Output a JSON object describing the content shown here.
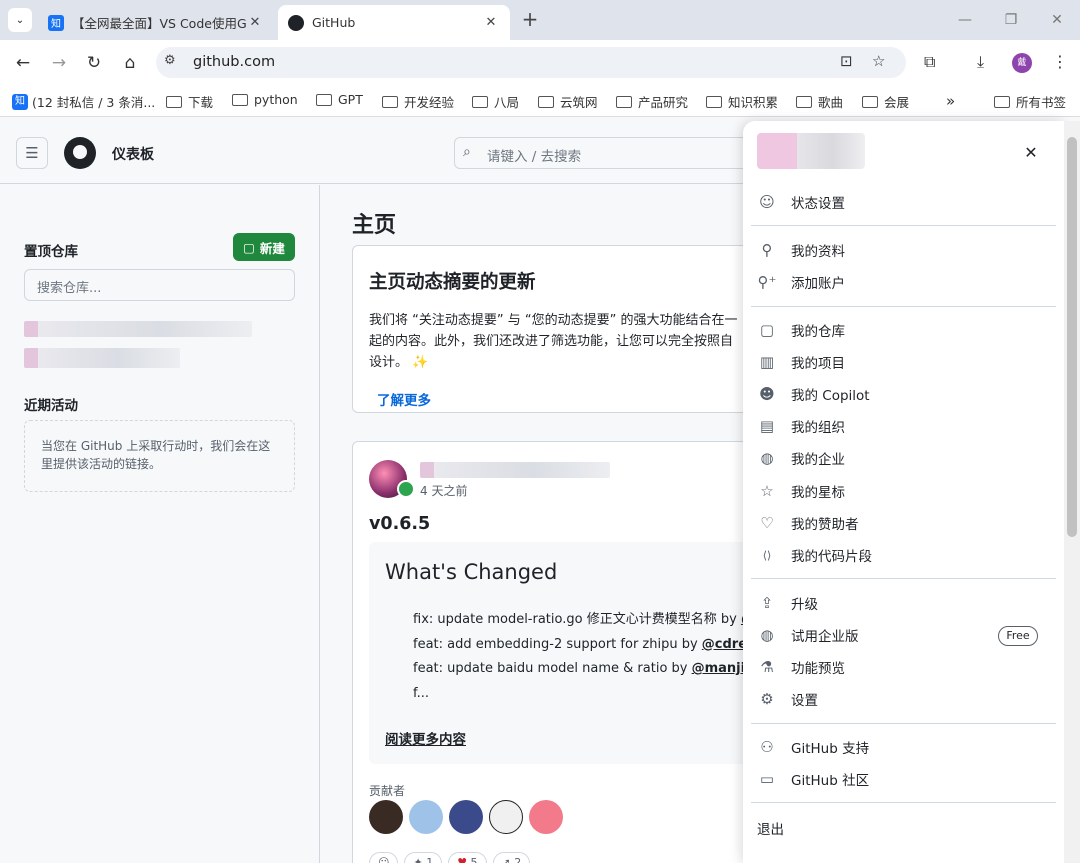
{
  "browser": {
    "tabs": [
      {
        "title": "【全网最全面】VS Code使用G",
        "favicon": "知",
        "active": false
      },
      {
        "title": "GitHub",
        "favicon": "github-icon",
        "active": true
      }
    ],
    "url": "github.com",
    "profile_initial": "戴",
    "bookmarks": [
      {
        "label": "(12 封私信 / 3 条消...",
        "type": "site"
      },
      {
        "label": "下载",
        "type": "folder"
      },
      {
        "label": "python",
        "type": "folder"
      },
      {
        "label": "GPT",
        "type": "folder"
      },
      {
        "label": "开发经验",
        "type": "folder"
      },
      {
        "label": "八局",
        "type": "folder"
      },
      {
        "label": "云筑网",
        "type": "folder"
      },
      {
        "label": "产品研究",
        "type": "folder"
      },
      {
        "label": "知识积累",
        "type": "folder"
      },
      {
        "label": "歌曲",
        "type": "folder"
      },
      {
        "label": "会展",
        "type": "folder"
      }
    ],
    "all_bookmarks": "所有书签",
    "more": "»"
  },
  "header": {
    "title": "仪表板",
    "search_placeholder": "请键入 / 去搜索",
    "slash_key": "/"
  },
  "sidebar": {
    "top_repos_heading": "置顶仓库",
    "new_button": "新建",
    "repo_search_placeholder": "搜索仓库...",
    "recent_heading": "近期活动",
    "recent_empty": "当您在 GitHub 上采取行动时，我们会在这里提供该活动的链接。"
  },
  "main": {
    "title": "主页",
    "update_card": {
      "title": "主页动态摘要的更新",
      "body": "我们将 “关注动态提要” 与 “您的动态提要” 的强大功能结合在一起的内容。此外，我们还改进了筛选功能，让您可以完全按照自设计。 ✨",
      "link": "了解更多"
    },
    "release_card": {
      "time": "4 天之前",
      "version": "v0.6.5",
      "changes_title": "What's Changed",
      "changes": [
        {
          "text": "fix: update model-ratio.go 修正文心计费模型名称 by ",
          "mention": "@"
        },
        {
          "text": "feat: add embedding-2 support for zhipu by ",
          "mention": "@cdredf"
        },
        {
          "text": "feat: update baidu model name & ratio by ",
          "mention": "@manjieqi"
        },
        {
          "text": "f...",
          "mention": ""
        }
      ],
      "read_more": "阅读更多内容",
      "contributors_label": "贡献者",
      "reactions": [
        "1",
        "5",
        "2"
      ]
    }
  },
  "menu": {
    "close": "✕",
    "items": [
      {
        "label": "状态设置",
        "icon": "smiley-icon",
        "glyph": "☺"
      },
      {
        "label": "我的资料",
        "icon": "person-icon",
        "glyph": "⚲"
      },
      {
        "label": "添加账户",
        "icon": "person-add-icon",
        "glyph": "⚲⁺"
      },
      {
        "label": "我的仓库",
        "icon": "repo-icon",
        "glyph": "▢"
      },
      {
        "label": "我的项目",
        "icon": "project-icon",
        "glyph": "▥"
      },
      {
        "label": "我的 Copilot",
        "icon": "copilot-icon",
        "glyph": "☻"
      },
      {
        "label": "我的组织",
        "icon": "organization-icon",
        "glyph": "▤"
      },
      {
        "label": "我的企业",
        "icon": "globe-icon",
        "glyph": "◍"
      },
      {
        "label": "我的星标",
        "icon": "star-icon",
        "glyph": "☆"
      },
      {
        "label": "我的赞助者",
        "icon": "heart-icon",
        "glyph": "♡"
      },
      {
        "label": "我的代码片段",
        "icon": "code-square-icon",
        "glyph": "⟨⟩"
      },
      {
        "label": "升级",
        "icon": "upload-icon",
        "glyph": "⇪"
      },
      {
        "label": "试用企业版",
        "icon": "globe-icon",
        "glyph": "◍"
      },
      {
        "label": "功能预览",
        "icon": "beaker-icon",
        "glyph": "⚗"
      },
      {
        "label": "设置",
        "icon": "gear-icon",
        "glyph": "⚙"
      },
      {
        "label": "GitHub 支持",
        "icon": "people-icon",
        "glyph": "⚇"
      },
      {
        "label": "GitHub 社区",
        "icon": "comment-discussion-icon",
        "glyph": "▭"
      },
      {
        "label": "退出",
        "icon": "",
        "glyph": ""
      }
    ],
    "free_badge": "Free"
  },
  "colors": {
    "primary_green": "#1f883d",
    "link_blue": "#0969da",
    "border": "#d0d7de",
    "profile_purple": "#8e44ad"
  }
}
